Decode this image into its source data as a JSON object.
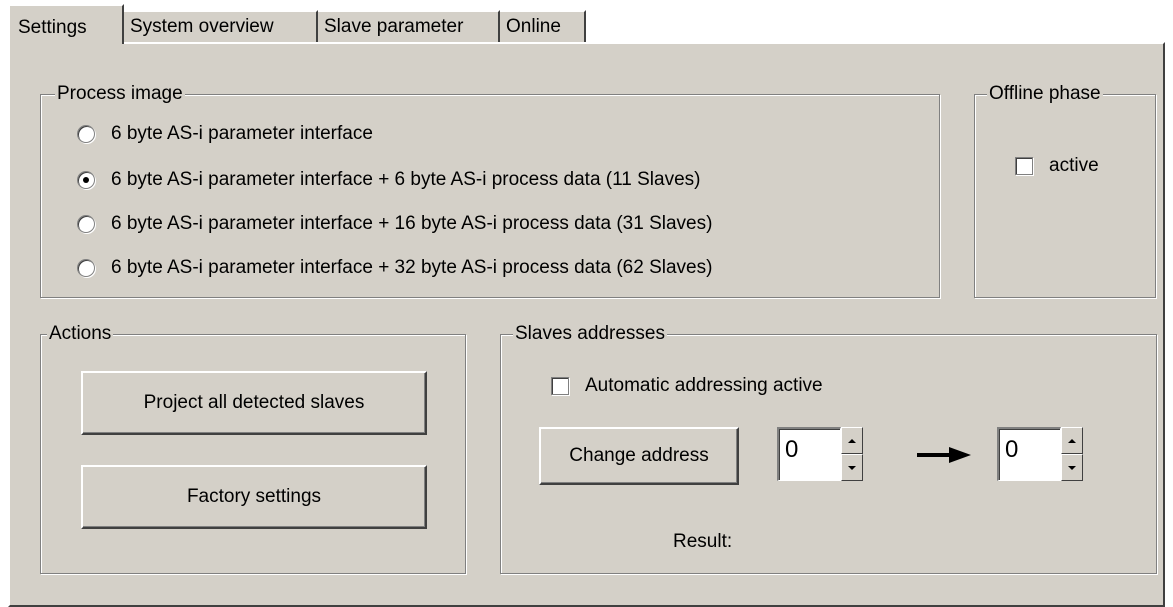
{
  "tabs": [
    {
      "label": "Settings",
      "active": true
    },
    {
      "label": "System overview",
      "active": false
    },
    {
      "label": "Slave parameter",
      "active": false
    },
    {
      "label": "Online",
      "active": false
    }
  ],
  "process_image": {
    "title": "Process image",
    "options": [
      {
        "label": "6 byte AS-i parameter interface",
        "checked": false
      },
      {
        "label": "6 byte AS-i parameter interface + 6 byte AS-i process data (11 Slaves)",
        "checked": true
      },
      {
        "label": "6 byte AS-i parameter interface + 16 byte AS-i process data (31 Slaves)",
        "checked": false
      },
      {
        "label": "6 byte AS-i parameter interface + 32 byte AS-i process data (62 Slaves)",
        "checked": false
      }
    ]
  },
  "offline_phase": {
    "title": "Offline phase",
    "active_label": "active",
    "active_checked": false
  },
  "actions": {
    "title": "Actions",
    "project_button": "Project all detected slaves",
    "factory_button": "Factory settings"
  },
  "slaves_addresses": {
    "title": "Slaves addresses",
    "auto_label": "Automatic addressing active",
    "auto_checked": false,
    "change_button": "Change address",
    "from_value": "0",
    "to_value": "0",
    "result_label": "Result:"
  }
}
